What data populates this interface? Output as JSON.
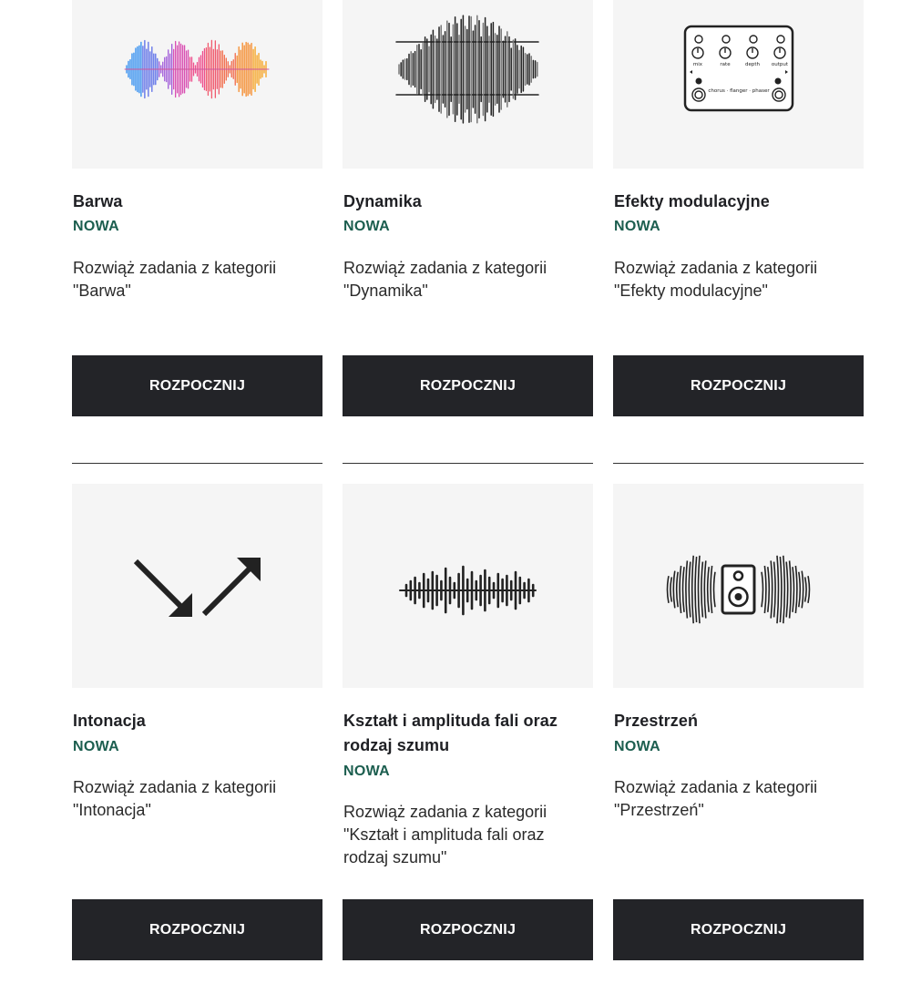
{
  "cards": [
    {
      "title": "Barwa",
      "badge": "NOWA",
      "description": "Rozwiąż zadania z kategorii \"Barwa\"",
      "button_label": "ROZPOCZNIJ",
      "icon": "colorful-waveform-icon"
    },
    {
      "title": "Dynamika",
      "badge": "NOWA",
      "description": "Rozwiąż zadania z kategorii \"Dynamika\"",
      "button_label": "ROZPOCZNIJ",
      "icon": "compressed-waveform-icon"
    },
    {
      "title": "Efekty modulacyjne",
      "badge": "NOWA",
      "description": "Rozwiąż zadania z kategorii \"Efekty modulacyjne\"",
      "button_label": "ROZPOCZNIJ",
      "icon": "effects-pedal-icon",
      "pedal_labels": [
        "mix",
        "rate",
        "depth",
        "output"
      ],
      "pedal_caption": "chorus · flanger · phaser"
    },
    {
      "title": "Intonacja",
      "badge": "NOWA",
      "description": "Rozwiąż zadania z kategorii \"Intonacja\"",
      "button_label": "ROZPOCZNIJ",
      "icon": "up-down-arrows-icon"
    },
    {
      "title": "Kształt i amplituda fali oraz rodzaj szumu",
      "badge": "NOWA",
      "description": "Rozwiąż zadania z kategorii \"Kształt i amplituda fali oraz rodzaj szumu\"",
      "button_label": "ROZPOCZNIJ",
      "icon": "waveform-bars-icon"
    },
    {
      "title": "Przestrzeń",
      "badge": "NOWA",
      "description": "Rozwiąż zadania z kategorii \"Przestrzeń\"",
      "button_label": "ROZPOCZNIJ",
      "icon": "speaker-sound-waves-icon"
    }
  ],
  "colors": {
    "badge": "#1c5e4f",
    "button_bg": "#232428",
    "thumb_bg": "#f5f5f5"
  }
}
